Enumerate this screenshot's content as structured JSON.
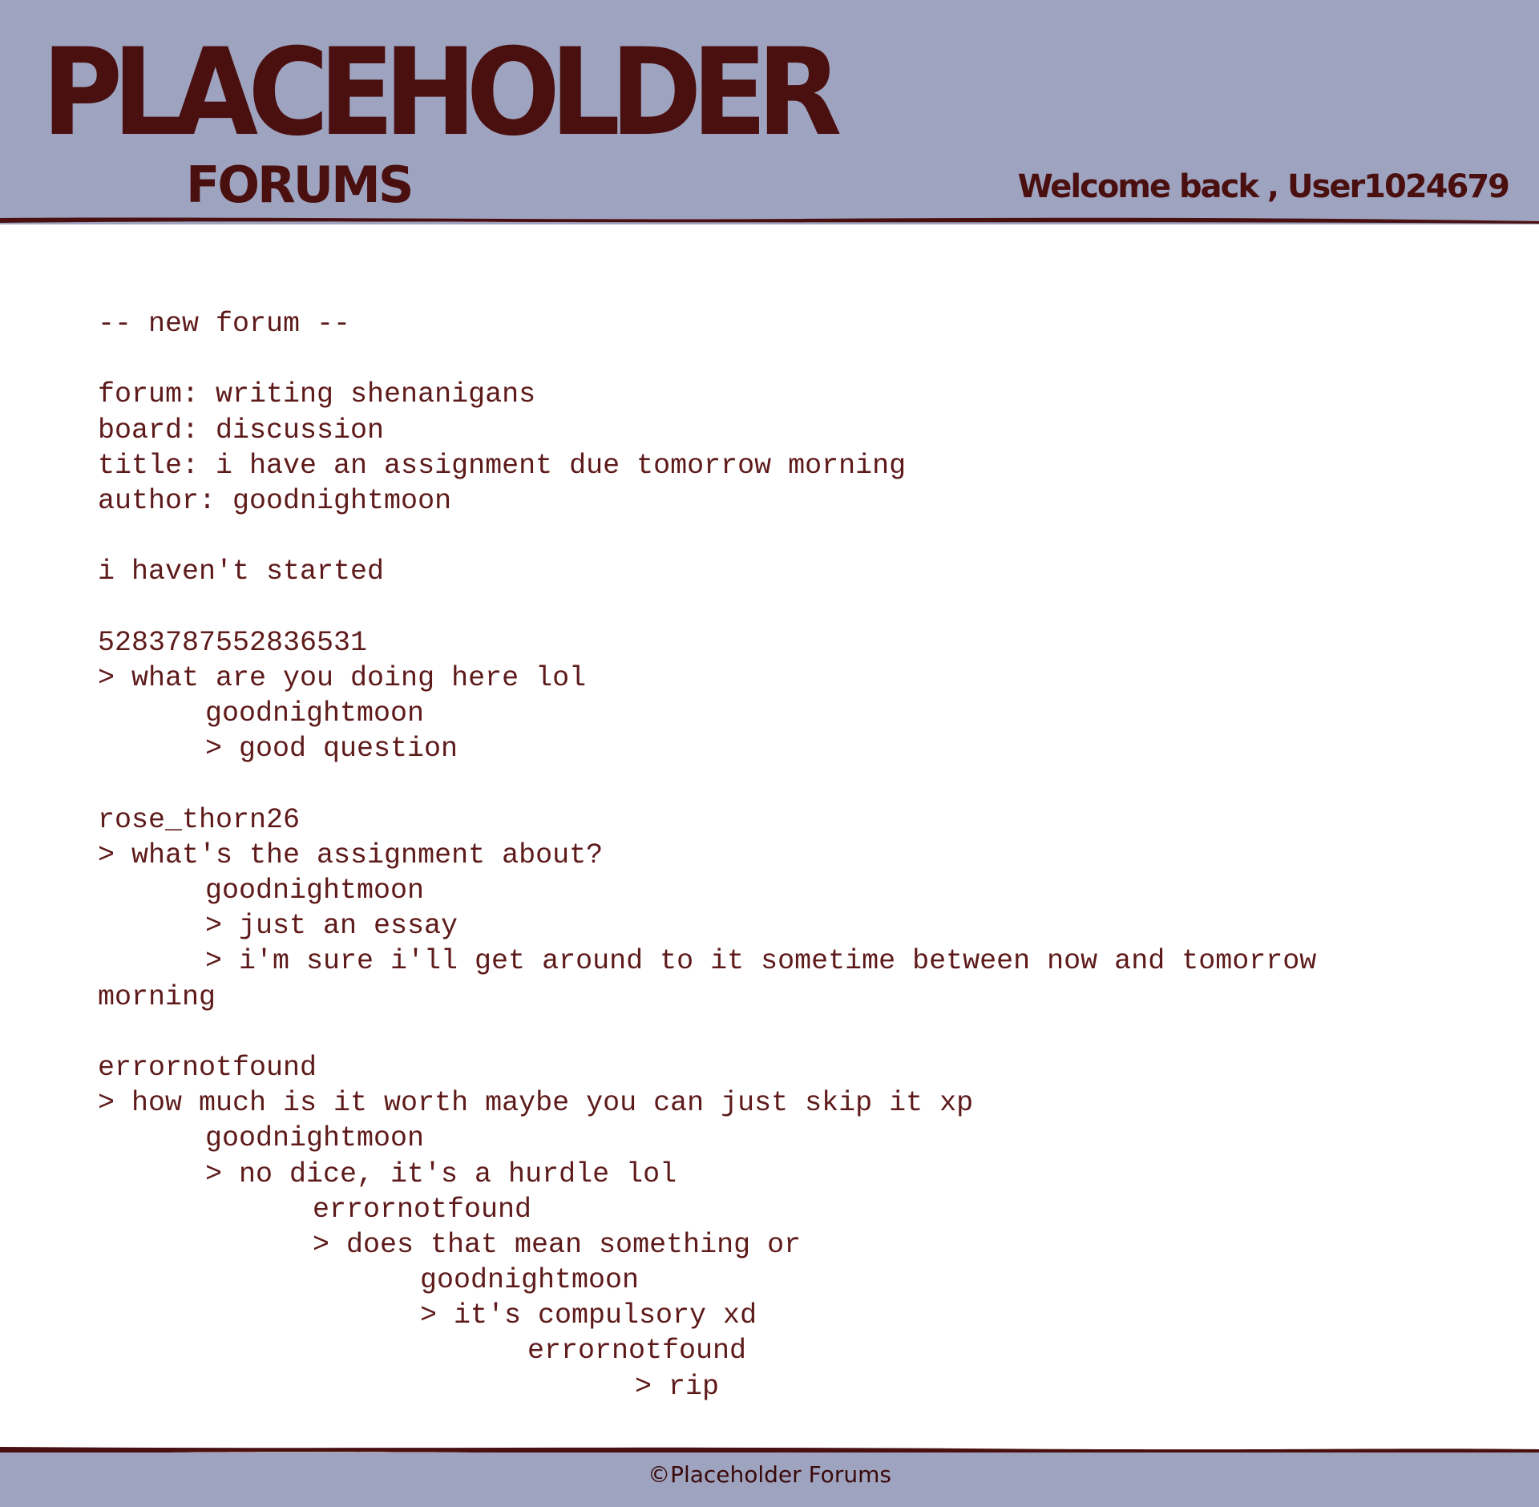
{
  "header": {
    "logo_title": "PLACEHOLDER",
    "logo_subtitle": "FORUMS",
    "welcome": "Welcome back , User1024679"
  },
  "post": {
    "heading": "-- new forum --",
    "forum_line": "forum: writing shenanigans",
    "board_line": "board: discussion",
    "title_line": "title: i have an assignment due tomorrow morning",
    "author_line": "author: goodnightmoon",
    "body": "i haven't started"
  },
  "thread1": {
    "user": "5283787552836531",
    "message": "> what are you doing here lol",
    "reply_user": "goodnightmoon",
    "reply_message": "> good question"
  },
  "thread2": {
    "user": "rose_thorn26",
    "message": "> what's the assignment about?",
    "reply_user": "goodnightmoon",
    "reply_message_1": "> just an essay",
    "reply_message_2": "> i'm sure i'll get around to it sometime between now and tomorrow",
    "reply_message_2_wrap": "morning"
  },
  "thread3": {
    "user": "errornotfound",
    "message": "> how much is it worth maybe you can just skip it xp",
    "reply1_user": "goodnightmoon",
    "reply1_message": "> no dice, it's a hurdle lol",
    "reply2_user": "errornotfound",
    "reply2_message": "> does that mean something or",
    "reply3_user": "goodnightmoon",
    "reply3_message": "> it's compulsory xd",
    "reply4_user": "errornotfound",
    "reply4_message": "> rip"
  },
  "footer": {
    "copyright": "©Placeholder Forums"
  },
  "colors": {
    "banner": "#9ea3c0",
    "ink": "#4a0f0f",
    "text": "#5e1a1a",
    "background": "#ffffff"
  }
}
